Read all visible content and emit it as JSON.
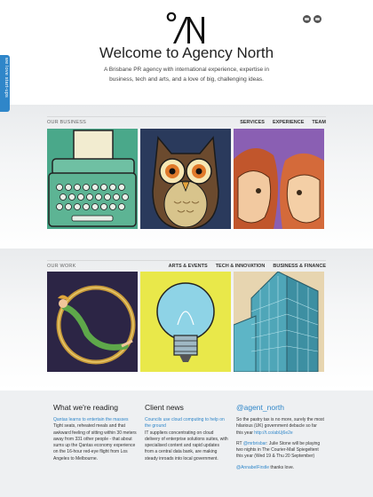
{
  "side_tab": {
    "label": "we love start-ups"
  },
  "header": {
    "title": "Welcome to Agency North",
    "tagline": "A Brisbane PR agency with international experience, expertise in business, tech and arts, and a love of big, challenging ideas."
  },
  "social": {
    "icons": [
      "linkedin-icon",
      "twitter-icon"
    ]
  },
  "business": {
    "label": "OUR BUSINESS",
    "nav": [
      "SERVICES",
      "EXPERIENCE",
      "TEAM"
    ]
  },
  "work": {
    "label": "OUR WORK",
    "nav": [
      "ARTS & EVENTS",
      "TECH & INNOVATION",
      "BUSINESS & FINANCE"
    ]
  },
  "footer": {
    "reading": {
      "heading": "What we're reading",
      "link": "Qantas learns to entertain the masses",
      "text": "Tight seats, reheated meals and that awkward feeling of sitting within 30 meters away from 331 other people - that about sums up the Qantas economy experience on the 16-hour red-eye flight from Los Angeles to Melbourne."
    },
    "news": {
      "heading": "Client news",
      "link": "Councils use cloud computing to help on the ground",
      "text": "IT suppliers concentrating on cloud delivery of enterprise solutions suites, with specialised content and rapid updates from a central data bank, are making steady inroads into local government."
    },
    "twitter": {
      "heading": "@agent_north",
      "t1_text": "So the pastry tax is no more, surely the most hilarious (UK) government debacle so far this year",
      "t1_link": "http://t.co/abUj6e2e",
      "t2_pre": "RT",
      "t2_handle": "@mrbrisbar",
      "t2_text": ": Julie Stone will be playing two nights in The Courier-Mail Spiegeltent this year (Wed 19 & Thu 20 September)",
      "t3_handle": "@AnnabelFirstle",
      "t3_text": " thanks love."
    }
  },
  "colors": {
    "accent": "#2f86c9",
    "footer_bg": "#eef0f2"
  }
}
